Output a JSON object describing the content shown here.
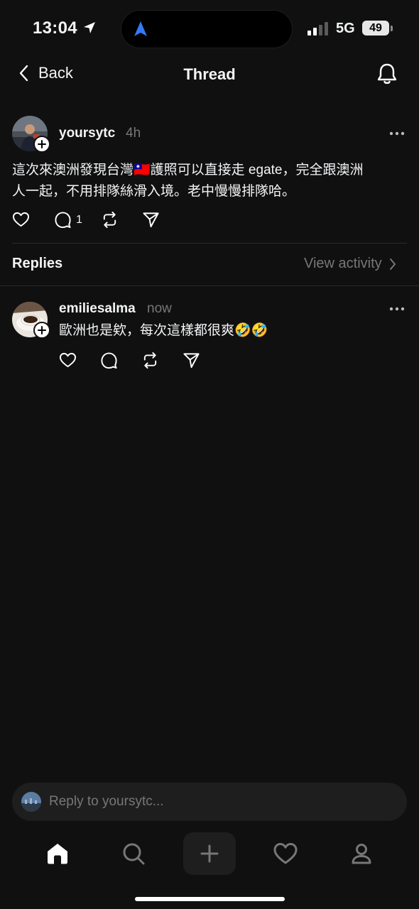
{
  "status_bar": {
    "time": "13:04",
    "network": "5G",
    "battery": "49"
  },
  "nav": {
    "back_label": "Back",
    "title": "Thread"
  },
  "main_post": {
    "username": "yoursytc",
    "time_ago": "4h",
    "text_line1": "這次來澳洲發現台灣🇹🇼護照可以直接走 egate，完全跟澳洲",
    "text_line2": "人一起，不用排隊絲滑入境。老中慢慢排隊哈。",
    "reply_count": "1"
  },
  "replies_header": {
    "label": "Replies",
    "view_activity": "View activity"
  },
  "replies": [
    {
      "username": "emiliesalma",
      "time_ago": "now",
      "text": "歐洲也是欸，每次這樣都很爽🤣🤣"
    }
  ],
  "reply_input": {
    "placeholder": "Reply to yoursytc..."
  },
  "tabs": [
    "home-icon",
    "search-icon",
    "create-icon",
    "heart-icon",
    "profile-icon"
  ],
  "colors": {
    "background": "#101010",
    "text": "#f3f5f7",
    "muted": "#777777",
    "accent_arrow": "#3478f6"
  }
}
